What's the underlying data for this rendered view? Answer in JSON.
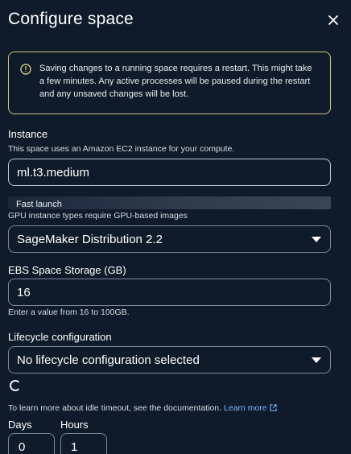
{
  "header": {
    "title": "Configure space"
  },
  "alert": {
    "message": "Saving changes to a running space requires a restart. This might take a few minutes. Any active processes will be paused during the restart and any unsaved changes will be lost."
  },
  "instance": {
    "label": "Instance",
    "description": "This space uses an Amazon EC2 instance for your compute.",
    "value": "ml.t3.medium",
    "fast_launch": "Fast launch"
  },
  "image": {
    "description": "GPU instance types require GPU-based images",
    "value": "SageMaker Distribution 2.2"
  },
  "storage": {
    "label": "EBS Space Storage (GB)",
    "value": "16",
    "hint": "Enter a value from 16 to 100GB."
  },
  "lifecycle": {
    "label": "Lifecycle configuration",
    "value": "No lifecycle configuration selected"
  },
  "idle": {
    "text": "To learn more about idle timeout, see the documentation.",
    "link": "Learn more",
    "days_label": "Days",
    "days_value": "0",
    "hours_label": "Hours",
    "hours_value": "1"
  },
  "colors": {
    "background": "#0f1b2a",
    "alert_border": "#cfc37a",
    "link": "#7fb4ff",
    "field_border": "#7d8998"
  },
  "icons": [
    "close-icon",
    "info-icon",
    "chevron-down-icon",
    "external-link-icon",
    "spinner-icon"
  ]
}
